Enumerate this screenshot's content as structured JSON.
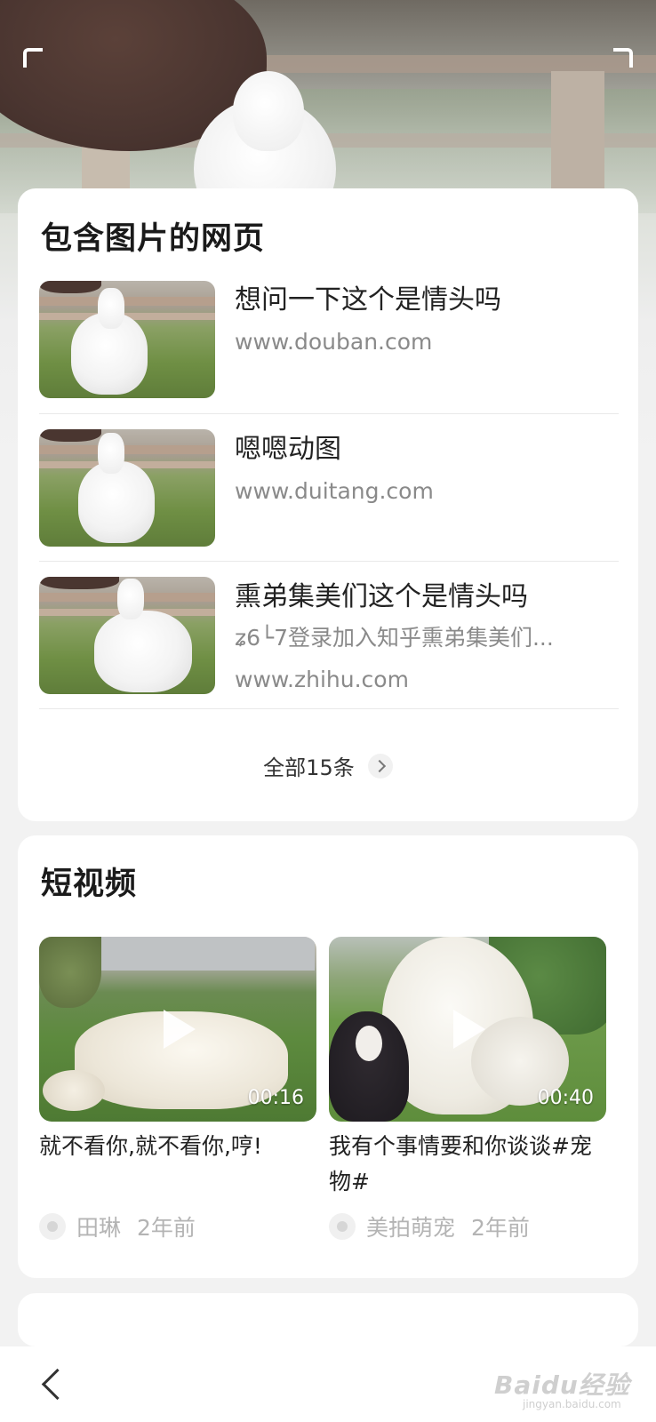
{
  "web_section": {
    "title": "包含图片的网页",
    "results": [
      {
        "title": "想问一下这个是情头吗",
        "url": "www.douban.com"
      },
      {
        "title": "嗯嗯动图",
        "url": "www.duitang.com"
      },
      {
        "title": "熏弟集美们这个是情头吗",
        "snippet": "ʑ6└7登录加入知乎熏弟集美们...",
        "url": "www.zhihu.com"
      }
    ],
    "more_label": "全部15条"
  },
  "video_section": {
    "title": "短视频",
    "videos": [
      {
        "duration": "00:16",
        "caption": "就不看你,就不看你,哼!",
        "author": "田琳",
        "time": "2年前"
      },
      {
        "duration": "00:40",
        "caption": "我有个事情要和你谈谈#宠物#",
        "author": "美拍萌宠",
        "time": "2年前"
      }
    ]
  },
  "watermark": {
    "brand": "Baidu经验",
    "sub": "jingyan.baidu.com"
  },
  "icons": [
    "back-arrow-icon",
    "chevron-right-icon",
    "play-icon",
    "paw-avatar-icon"
  ]
}
